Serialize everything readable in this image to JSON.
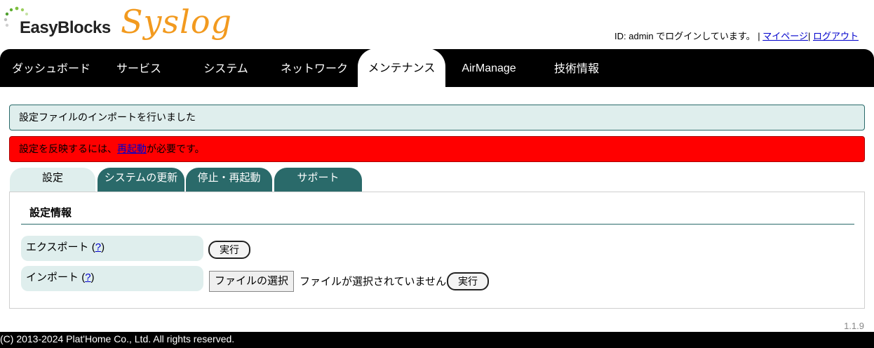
{
  "header": {
    "logo_text": "EasyBlocks",
    "product_name": "Syslog",
    "login_prefix": "ID: admin でログインしています。",
    "sep1": "|",
    "mypage_link": "マイページ",
    "sep2": "|",
    "logout_link": "ログアウト"
  },
  "nav": {
    "items": [
      {
        "label": "ダッシュボード"
      },
      {
        "label": "サービス"
      },
      {
        "label": "システム"
      },
      {
        "label": "ネットワーク"
      },
      {
        "label": "メンテナンス",
        "active": true
      },
      {
        "label": "AirManage"
      },
      {
        "label": "技術情報"
      }
    ]
  },
  "messages": {
    "info": "設定ファイルのインポートを行いました",
    "warn_prefix": "設定を反映するには、",
    "warn_link": "再起動",
    "warn_suffix": "が必要です。"
  },
  "subtabs": [
    {
      "label": "設定",
      "active": true
    },
    {
      "label": "システムの更新"
    },
    {
      "label": "停止・再起動"
    },
    {
      "label": "サポート"
    }
  ],
  "panel": {
    "title": "設定情報",
    "export_label": "エクスポート",
    "import_label": "インポート",
    "help_link": "?",
    "open_paren": "(",
    "close_paren": ")",
    "execute_label": "実行",
    "file_select_label": "ファイルの選択",
    "file_status": "ファイルが選択されていません"
  },
  "version": "1.1.9",
  "footer": "(C) 2013-2024 Plat'Home Co., Ltd. All rights reserved.",
  "colors": {
    "accent": "#2a6a6a",
    "light_accent": "#dfeeed",
    "warning": "#ff0000",
    "logo_orange": "#f29a1f"
  }
}
